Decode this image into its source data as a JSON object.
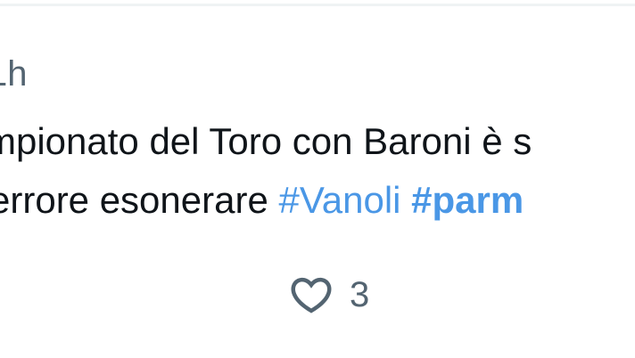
{
  "post": {
    "timestamp": "1h",
    "text_line_1": "mpionato del Toro con Baroni è s",
    "text_line_2_prefix": "errore esonerare ",
    "hashtag_1": "#Vanoli",
    "hashtag_2": "#parm"
  },
  "actions": {
    "like_icon": "heart-outline",
    "like_count": "3"
  },
  "colors": {
    "text": "#0f1419",
    "secondary": "#536471",
    "link": "#4a97e6",
    "divider": "#eff3f4"
  }
}
